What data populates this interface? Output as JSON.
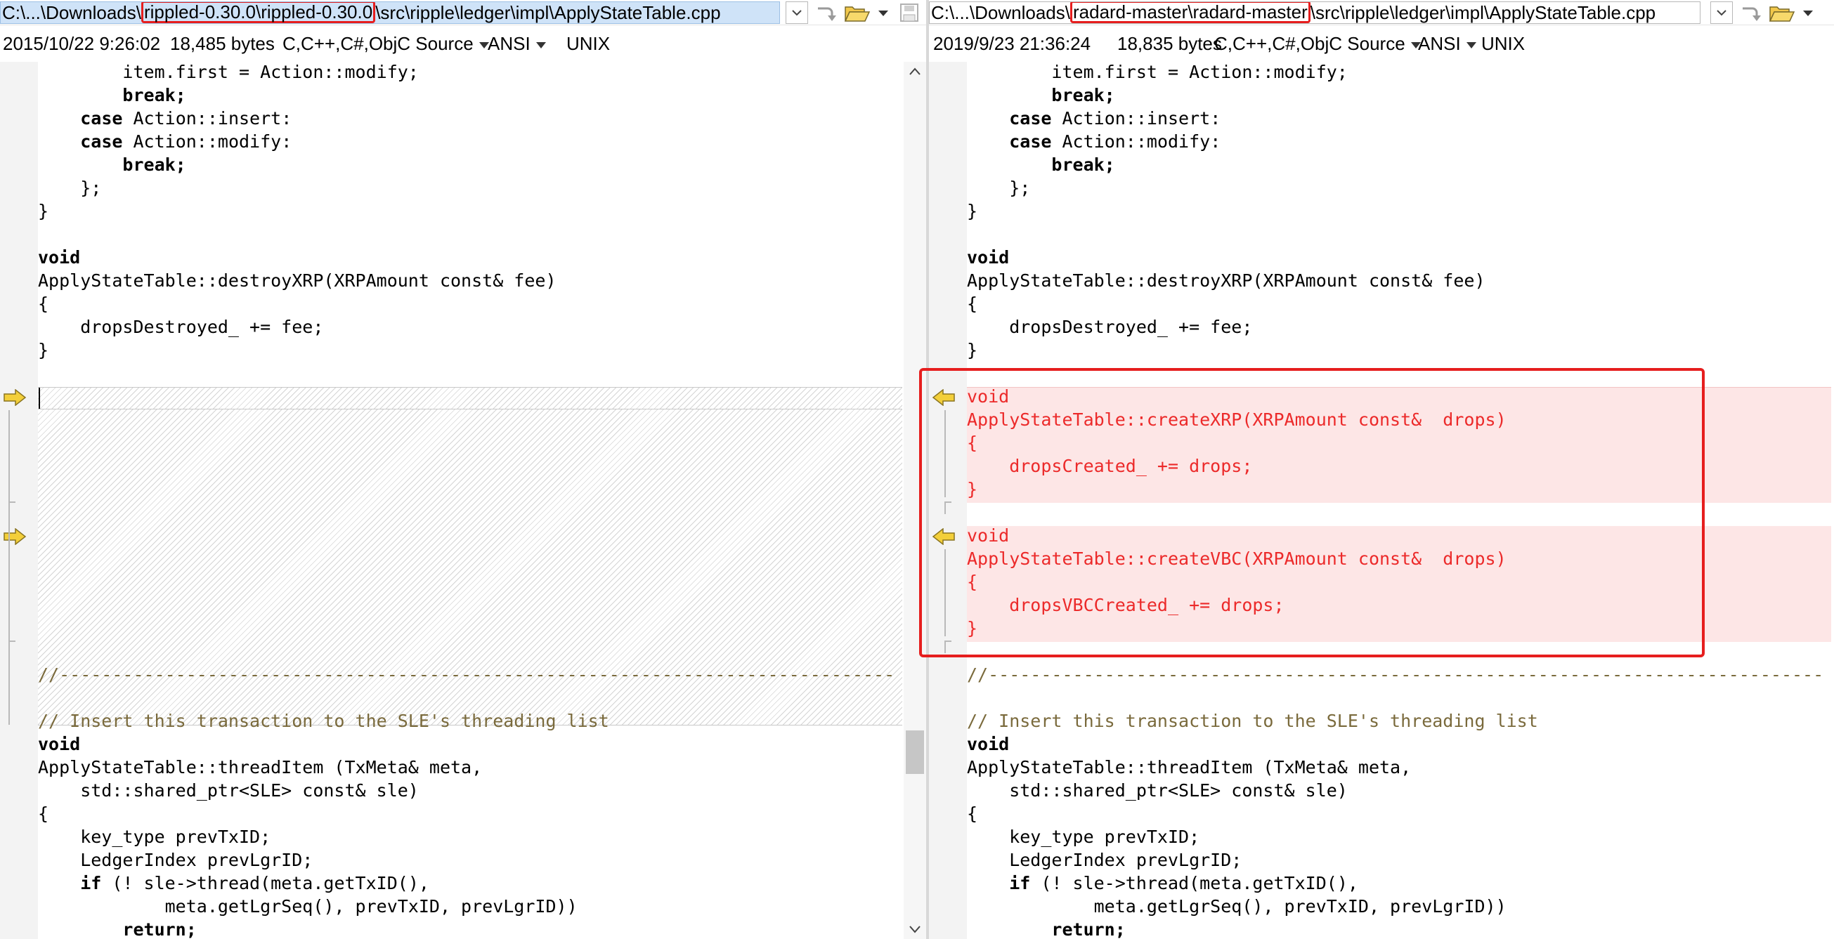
{
  "left": {
    "path": {
      "prefix": "C:\\...\\Downloads\\",
      "highlight": "rippled-0.30.0\\rippled-0.30.0",
      "suffix": "\\src\\ripple\\ledger\\impl\\ApplyStateTable.cpp"
    },
    "info": {
      "timestamp": "2015/10/22 9:26:02",
      "size": "18,485 bytes",
      "language": "C,C++,C#,ObjC Source",
      "encoding": "ANSI",
      "line_endings": "UNIX"
    },
    "lines": [
      "        item.first = Action::modify;",
      "        break;",
      "    case Action::insert:",
      "    case Action::modify:",
      "        break;",
      "    };",
      "}",
      "",
      "void",
      "ApplyStateTable::destroyXRP(XRPAmount const& fee)",
      "{",
      "    dropsDestroyed_ += fee;",
      "}",
      "//-------------------------------------------------------------------------------",
      "",
      "// Insert this transaction to the SLE's threading list",
      "void",
      "ApplyStateTable::threadItem (TxMeta& meta,",
      "    std::shared_ptr<SLE> const& sle)",
      "{",
      "    key_type prevTxID;",
      "    LedgerIndex prevLgrID;",
      "    if (! sle->thread(meta.getTxID(),",
      "            meta.getLgrSeq(), prevTxID, prevLgrID))",
      "        return;"
    ]
  },
  "right": {
    "path": {
      "prefix": "C:\\...\\Downloads\\",
      "highlight": "radard-master\\radard-master",
      "suffix": "\\src\\ripple\\ledger\\impl\\ApplyStateTable.cpp"
    },
    "info": {
      "timestamp": "2019/9/23 21:36:24",
      "size": "18,835 bytes",
      "language": "C,C++,C#,ObjC Source",
      "encoding": "ANSI",
      "line_endings": "UNIX"
    },
    "lines": [
      "        item.first = Action::modify;",
      "        break;",
      "    case Action::insert:",
      "    case Action::modify:",
      "        break;",
      "    };",
      "}",
      "",
      "void",
      "ApplyStateTable::destroyXRP(XRPAmount const& fee)",
      "{",
      "    dropsDestroyed_ += fee;",
      "}",
      "",
      "void",
      "ApplyStateTable::createXRP(XRPAmount const&  drops)",
      "{",
      "    dropsCreated_ += drops;",
      "}",
      "",
      "void",
      "ApplyStateTable::createVBC(XRPAmount const&  drops)",
      "{",
      "    dropsVBCCreated_ += drops;",
      "}",
      "//-------------------------------------------------------------------------------",
      "",
      "// Insert this transaction to the SLE's threading list",
      "void",
      "ApplyStateTable::threadItem (TxMeta& meta,",
      "    std::shared_ptr<SLE> const& sle)",
      "{",
      "    key_type prevTxID;",
      "    LedgerIndex prevLgrID;",
      "    if (! sle->thread(meta.getTxID(),",
      "            meta.getLgrSeq(), prevTxID, prevLgrID))",
      "        return;"
    ]
  },
  "colors": {
    "changed_text": "#ec2a2a",
    "changed_background": "#fde6e6",
    "annotation_red": "#e61e1e",
    "comment_text": "#7a6a3c",
    "path_selection": "#cfe3f8"
  },
  "icons": [
    "chevron-down-icon",
    "next-difference-icon",
    "open-folder-icon",
    "save-icon",
    "difference-arrow-icon",
    "scroll-up-icon",
    "scroll-down-icon"
  ]
}
